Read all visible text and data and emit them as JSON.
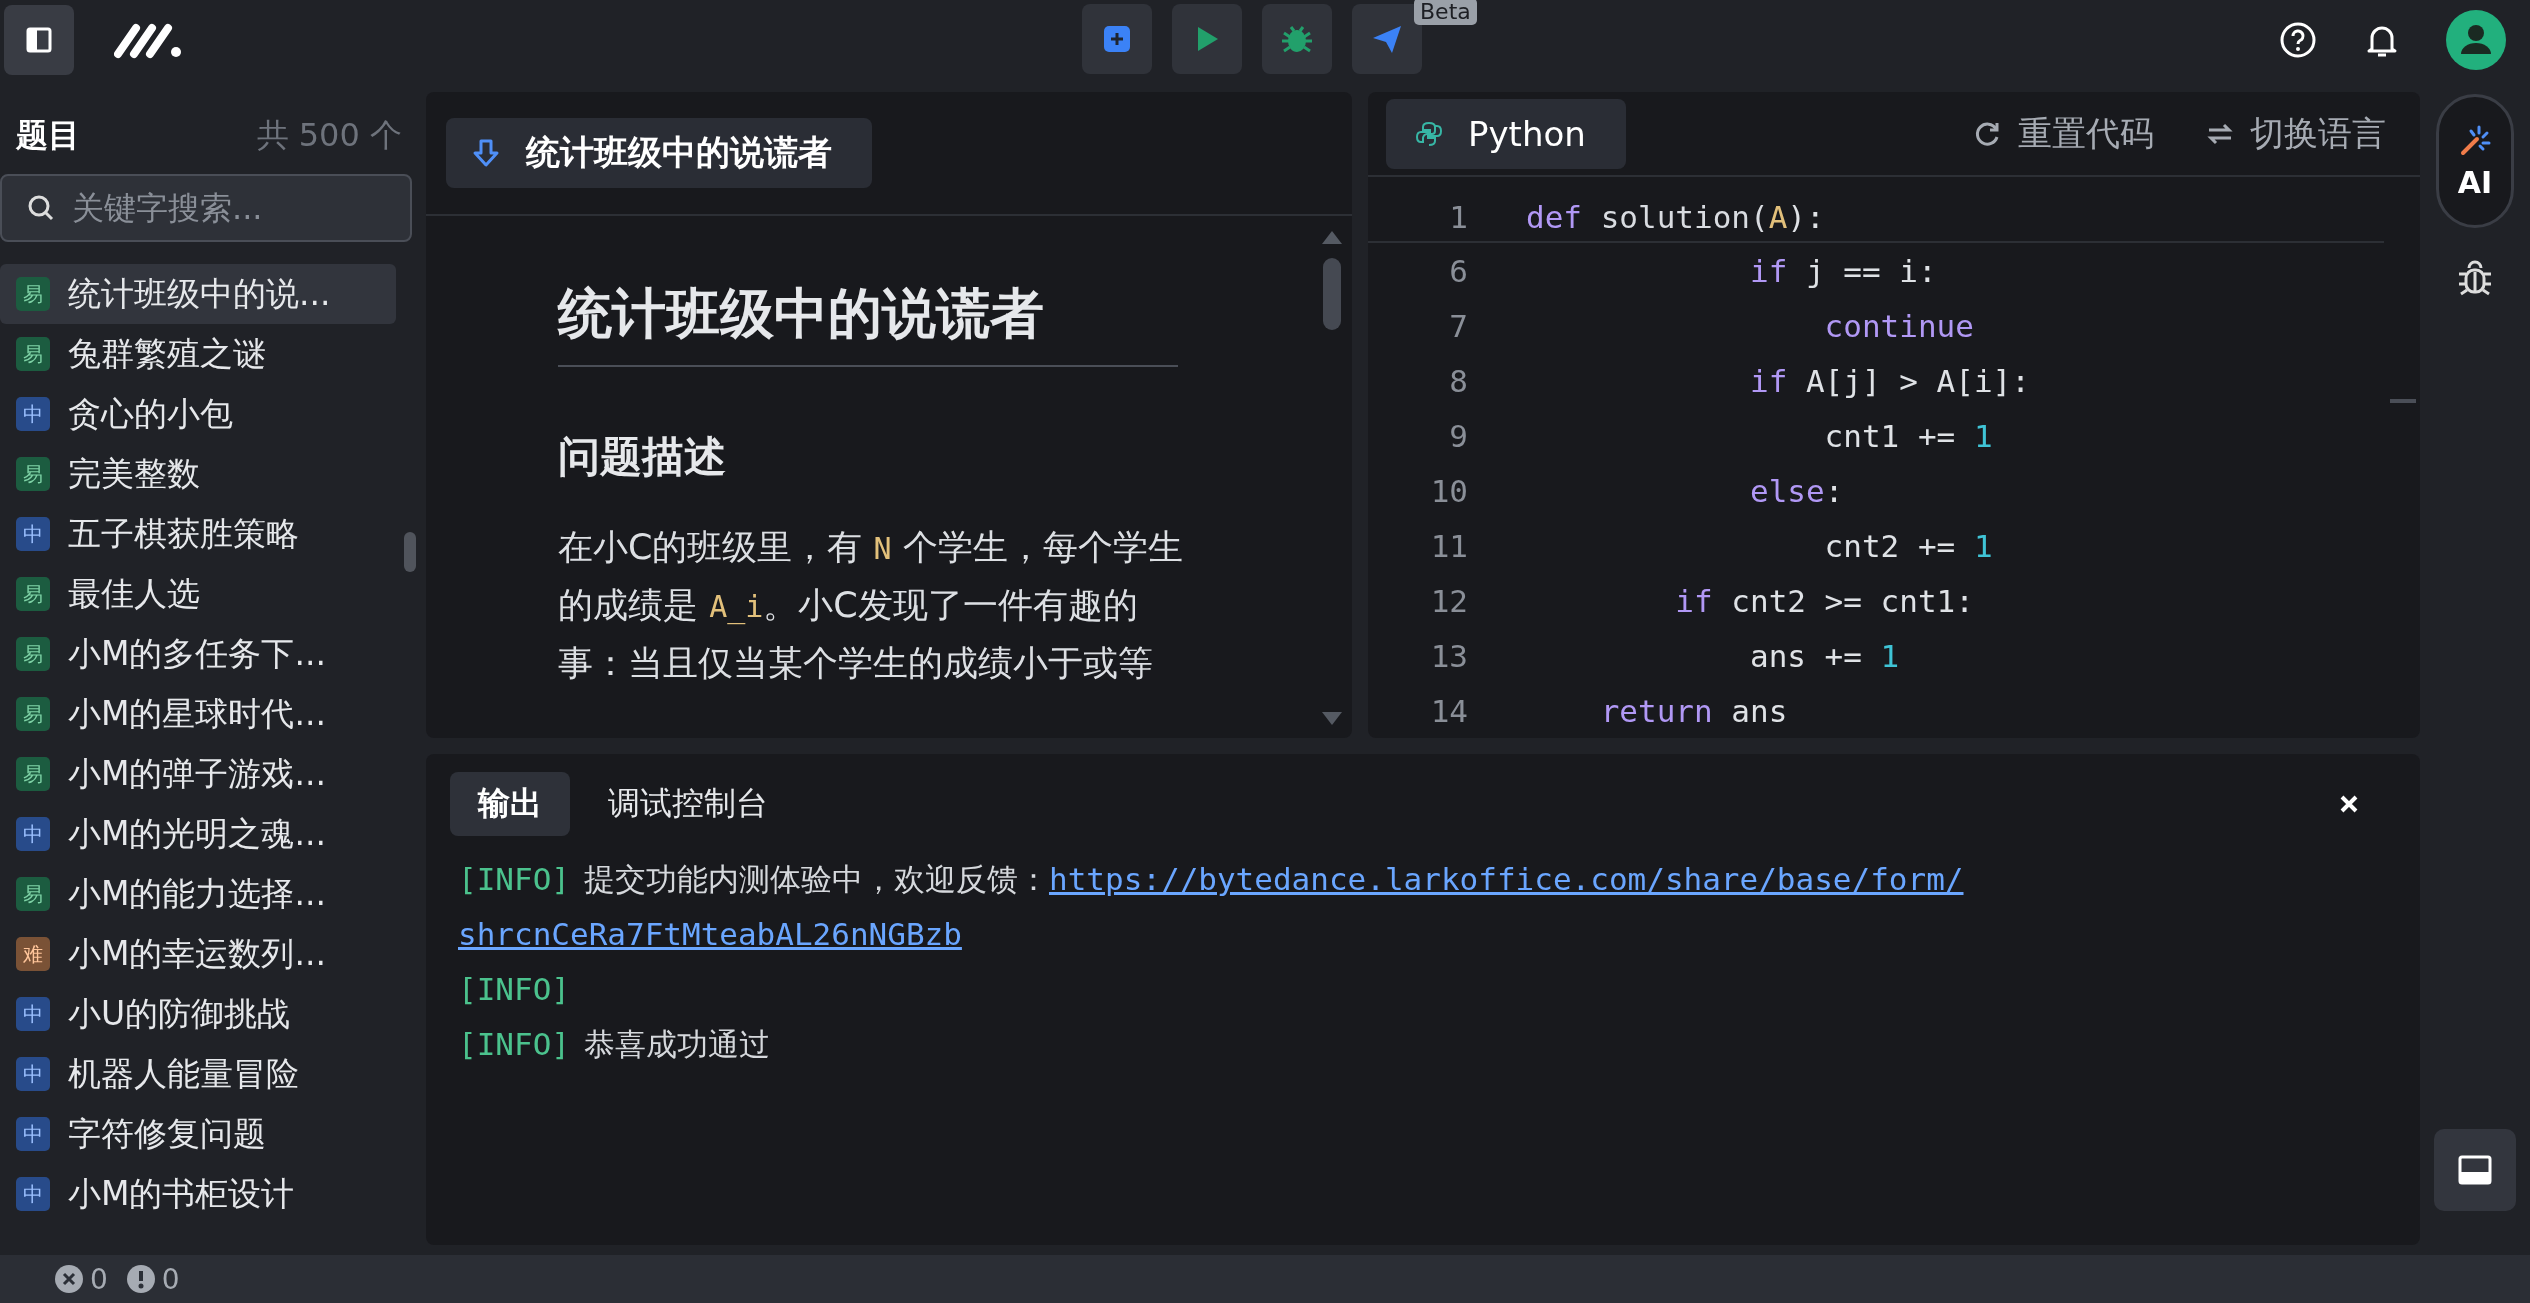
{
  "top_bar": {
    "tools": [
      {
        "kind": "add"
      },
      {
        "kind": "run"
      },
      {
        "kind": "debug"
      },
      {
        "kind": "submit",
        "badge": "Beta"
      }
    ]
  },
  "sidebar": {
    "title": "题目",
    "count": "共 500 个",
    "search": {
      "placeholder": "关键字搜索..."
    },
    "items": [
      {
        "tag": "易",
        "kind": "easy",
        "label": "统计班级中的说...",
        "selected": true
      },
      {
        "tag": "易",
        "kind": "easy",
        "label": "兔群繁殖之谜",
        "selected": false
      },
      {
        "tag": "中",
        "kind": "medium",
        "label": "贪心的小包",
        "selected": false
      },
      {
        "tag": "易",
        "kind": "easy",
        "label": "完美整数",
        "selected": false
      },
      {
        "tag": "中",
        "kind": "medium",
        "label": "五子棋获胜策略",
        "selected": false
      },
      {
        "tag": "易",
        "kind": "easy",
        "label": "最佳人选",
        "selected": false
      },
      {
        "tag": "易",
        "kind": "easy",
        "label": "小M的多任务下...",
        "selected": false
      },
      {
        "tag": "易",
        "kind": "easy",
        "label": "小M的星球时代...",
        "selected": false
      },
      {
        "tag": "易",
        "kind": "easy",
        "label": "小M的弹子游戏...",
        "selected": false
      },
      {
        "tag": "中",
        "kind": "medium",
        "label": "小M的光明之魂...",
        "selected": false
      },
      {
        "tag": "易",
        "kind": "easy",
        "label": "小M的能力选择...",
        "selected": false
      },
      {
        "tag": "难",
        "kind": "hard",
        "label": "小M的幸运数列...",
        "selected": false
      },
      {
        "tag": "中",
        "kind": "medium",
        "label": "小U的防御挑战",
        "selected": false
      },
      {
        "tag": "中",
        "kind": "medium",
        "label": "机器人能量冒险",
        "selected": false
      },
      {
        "tag": "中",
        "kind": "medium",
        "label": "字符修复问题",
        "selected": false
      },
      {
        "tag": "中",
        "kind": "medium",
        "label": "小M的书柜设计",
        "selected": false
      }
    ]
  },
  "problem": {
    "tab": "统计班级中的说谎者",
    "title": "统计班级中的说谎者",
    "section": "问题描述",
    "paragraph": [
      {
        "kind": "text",
        "t": "在小C的班级里，有 "
      },
      {
        "kind": "code",
        "t": "N"
      },
      {
        "kind": "text",
        "t": " 个学生，每个学生的成绩是 "
      },
      {
        "kind": "code",
        "t": "A_i"
      },
      {
        "kind": "text",
        "t": "。小C发现了一件有趣的事：当且仅当某个学生的成绩小于或等"
      }
    ]
  },
  "editor": {
    "language": "Python",
    "actions": [
      {
        "kind": "reset",
        "label": "重置代码"
      },
      {
        "kind": "switch",
        "label": "切换语言"
      }
    ],
    "sticky_line": {
      "n": "1",
      "tokens": [
        {
          "kind": "kw",
          "t": "def"
        },
        {
          "kind": "fn",
          "t": " solution("
        },
        {
          "kind": "param",
          "t": "A"
        },
        {
          "kind": "plain",
          "t": "):"
        }
      ]
    },
    "lines": [
      {
        "n": "6",
        "tokens": [
          {
            "kind": "kw",
            "t": "            if"
          },
          {
            "kind": "plain",
            "t": " j == i:"
          }
        ]
      },
      {
        "n": "7",
        "tokens": [
          {
            "kind": "kw",
            "t": "                continue"
          }
        ]
      },
      {
        "n": "8",
        "tokens": [
          {
            "kind": "kw",
            "t": "            if"
          },
          {
            "kind": "plain",
            "t": " A[j] > A[i]:"
          }
        ]
      },
      {
        "n": "9",
        "tokens": [
          {
            "kind": "plain",
            "t": "                cnt1 += "
          },
          {
            "kind": "num",
            "t": "1"
          }
        ]
      },
      {
        "n": "10",
        "tokens": [
          {
            "kind": "kw",
            "t": "            else"
          },
          {
            "kind": "plain",
            "t": ":"
          }
        ]
      },
      {
        "n": "11",
        "tokens": [
          {
            "kind": "plain",
            "t": "                cnt2 += "
          },
          {
            "kind": "num",
            "t": "1"
          }
        ]
      },
      {
        "n": "12",
        "tokens": [
          {
            "kind": "kw",
            "t": "        if"
          },
          {
            "kind": "plain",
            "t": " cnt2 >= cnt1:"
          }
        ]
      },
      {
        "n": "13",
        "tokens": [
          {
            "kind": "plain",
            "t": "            ans += "
          },
          {
            "kind": "num",
            "t": "1"
          }
        ]
      },
      {
        "n": "14",
        "tokens": [
          {
            "kind": "kw",
            "t": "    return"
          },
          {
            "kind": "plain",
            "t": " ans"
          }
        ]
      }
    ]
  },
  "output": {
    "tabs": [
      {
        "label": "输出",
        "selected": true
      },
      {
        "label": "调试控制台",
        "selected": false
      }
    ],
    "lines": [
      {
        "tag": "[INFO]",
        "text": "提交功能内测体验中，欢迎反馈：",
        "link_lines": [
          "https://bytedance.larkoffice.com/share/base/form/",
          "shrcnCeRa7FtMteabAL26nNGBzb"
        ]
      },
      {
        "tag": "[INFO]"
      },
      {
        "tag": "[INFO]",
        "text": "恭喜成功通过"
      }
    ]
  },
  "rail": {
    "ai_label": "AI"
  },
  "status_bar": {
    "errors": "0",
    "warnings": "0"
  }
}
